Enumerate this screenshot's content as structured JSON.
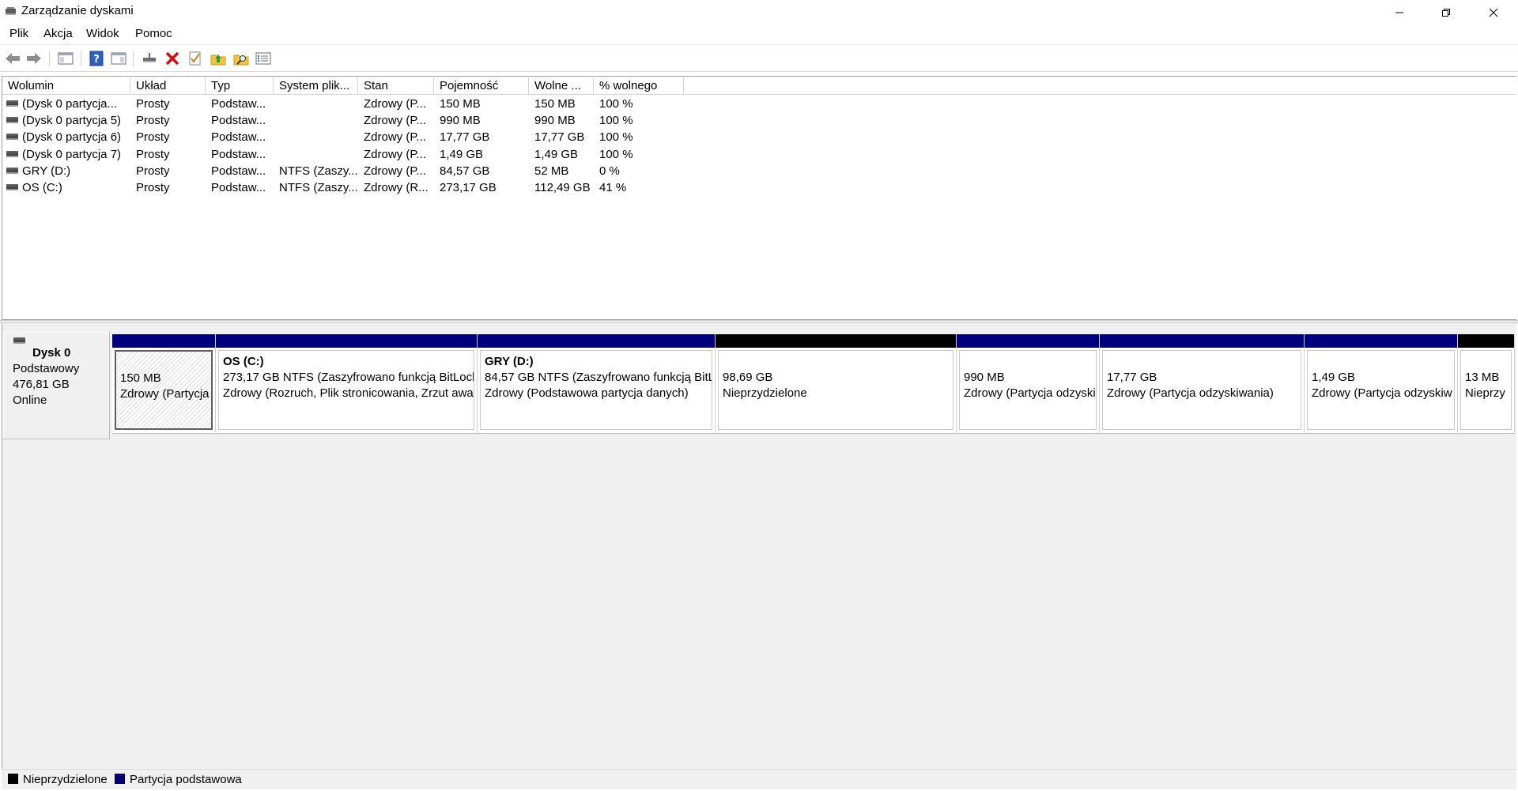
{
  "window": {
    "title": "Zarządzanie dyskami",
    "icon": "disk-management-icon",
    "controls": [
      "minimize-icon",
      "restore-icon",
      "close-icon"
    ]
  },
  "menu": [
    "Plik",
    "Akcja",
    "Widok",
    "Pomoc"
  ],
  "toolbar": [
    "back-arrow-icon",
    "forward-arrow-icon",
    "console-tree-icon",
    "help-icon",
    "show-hide-pane-icon",
    "connect-drive-icon",
    "delete-icon",
    "properties-check-icon",
    "folder-up-icon",
    "folder-search-icon",
    "list-view-icon"
  ],
  "volume_list": {
    "columns": [
      "Wolumin",
      "Układ",
      "Typ",
      "System plik...",
      "Stan",
      "Pojemność",
      "Wolne ...",
      "% wolnego"
    ],
    "rows": [
      [
        "(Dysk 0 partycja...",
        "Prosty",
        "Podstaw...",
        "",
        "Zdrowy (P...",
        "150 MB",
        "150 MB",
        "100 %"
      ],
      [
        "(Dysk 0 partycja 5)",
        "Prosty",
        "Podstaw...",
        "",
        "Zdrowy (P...",
        "990 MB",
        "990 MB",
        "100 %"
      ],
      [
        "(Dysk 0 partycja 6)",
        "Prosty",
        "Podstaw...",
        "",
        "Zdrowy (P...",
        "17,77 GB",
        "17,77 GB",
        "100 %"
      ],
      [
        "(Dysk 0 partycja 7)",
        "Prosty",
        "Podstaw...",
        "",
        "Zdrowy (P...",
        "1,49 GB",
        "1,49 GB",
        "100 %"
      ],
      [
        "GRY (D:)",
        "Prosty",
        "Podstaw...",
        "NTFS (Zaszy...",
        "Zdrowy (P...",
        "84,57 GB",
        "52 MB",
        "0 %"
      ],
      [
        "OS (C:)",
        "Prosty",
        "Podstaw...",
        "NTFS (Zaszy...",
        "Zdrowy (R...",
        "273,17 GB",
        "112,49 GB",
        "41 %"
      ]
    ]
  },
  "disk": {
    "name": "Dysk 0",
    "type": "Podstawowy",
    "size": "476,81 GB",
    "status": "Online",
    "partitions": [
      {
        "title": "",
        "line1": "150 MB",
        "line2": "Zdrowy (Partycja",
        "bar": "#00007f",
        "selected": true
      },
      {
        "title": "OS  (C:)",
        "line1": "273,17 GB NTFS (Zaszyfrowano funkcją BitLock",
        "line2": "Zdrowy (Rozruch, Plik stronicowania, Zrzut awa",
        "bar": "#00007f",
        "selected": false
      },
      {
        "title": "GRY  (D:)",
        "line1": "84,57 GB NTFS (Zaszyfrowano funkcją BitL",
        "line2": "Zdrowy (Podstawowa partycja danych)",
        "bar": "#00007f",
        "selected": false
      },
      {
        "title": "",
        "line1": "98,69 GB",
        "line2": "Nieprzydzielone",
        "bar": "#000000",
        "selected": false
      },
      {
        "title": "",
        "line1": "990 MB",
        "line2": "Zdrowy (Partycja odzyski",
        "bar": "#00007f",
        "selected": false
      },
      {
        "title": "",
        "line1": "17,77 GB",
        "line2": "Zdrowy (Partycja odzyskiwania)",
        "bar": "#00007f",
        "selected": false
      },
      {
        "title": "",
        "line1": "1,49 GB",
        "line2": "Zdrowy (Partycja odzyskiw",
        "bar": "#00007f",
        "selected": false
      },
      {
        "title": "",
        "line1": "13 MB",
        "line2": "Nieprzy",
        "bar": "#000000",
        "selected": false
      }
    ]
  },
  "legend": [
    {
      "label": "Nieprzydzielone",
      "color": "#000000"
    },
    {
      "label": "Partycja podstawowa",
      "color": "#00007f"
    }
  ]
}
